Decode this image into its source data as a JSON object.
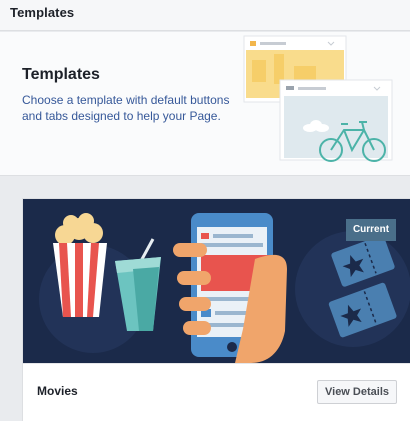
{
  "topbar": {
    "title": "Templates"
  },
  "hero": {
    "title": "Templates",
    "description": "Choose a template with default buttons and tabs designed to help your Page."
  },
  "template_card": {
    "name": "Movies",
    "badge": "Current",
    "view_details_label": "View Details",
    "illustration": "movies-illustration"
  },
  "colors": {
    "card_background": "#1b2a4a",
    "badge": "#4a6f8a",
    "link_text": "#365899",
    "accent_yellow": "#f7d794",
    "accent_red": "#e8544e",
    "accent_teal": "#6cc4c0"
  }
}
